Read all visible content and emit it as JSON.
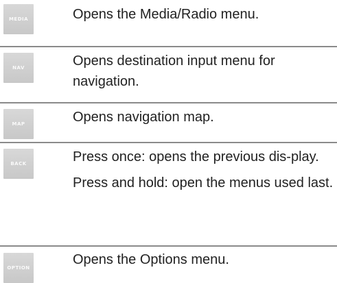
{
  "rows": [
    {
      "button": "MEDIA",
      "text": [
        "Opens the Media/Radio menu."
      ]
    },
    {
      "button": "NAV",
      "text": [
        "Opens destination input menu for navigation."
      ]
    },
    {
      "button": "MAP",
      "text": [
        "Opens navigation map."
      ]
    },
    {
      "button": "BACK",
      "text": [
        "Press once: opens the previous dis-play.",
        "Press and hold: open the menus used last."
      ]
    },
    {
      "button": "OPTION",
      "text": [
        "Opens the Options menu."
      ]
    }
  ]
}
